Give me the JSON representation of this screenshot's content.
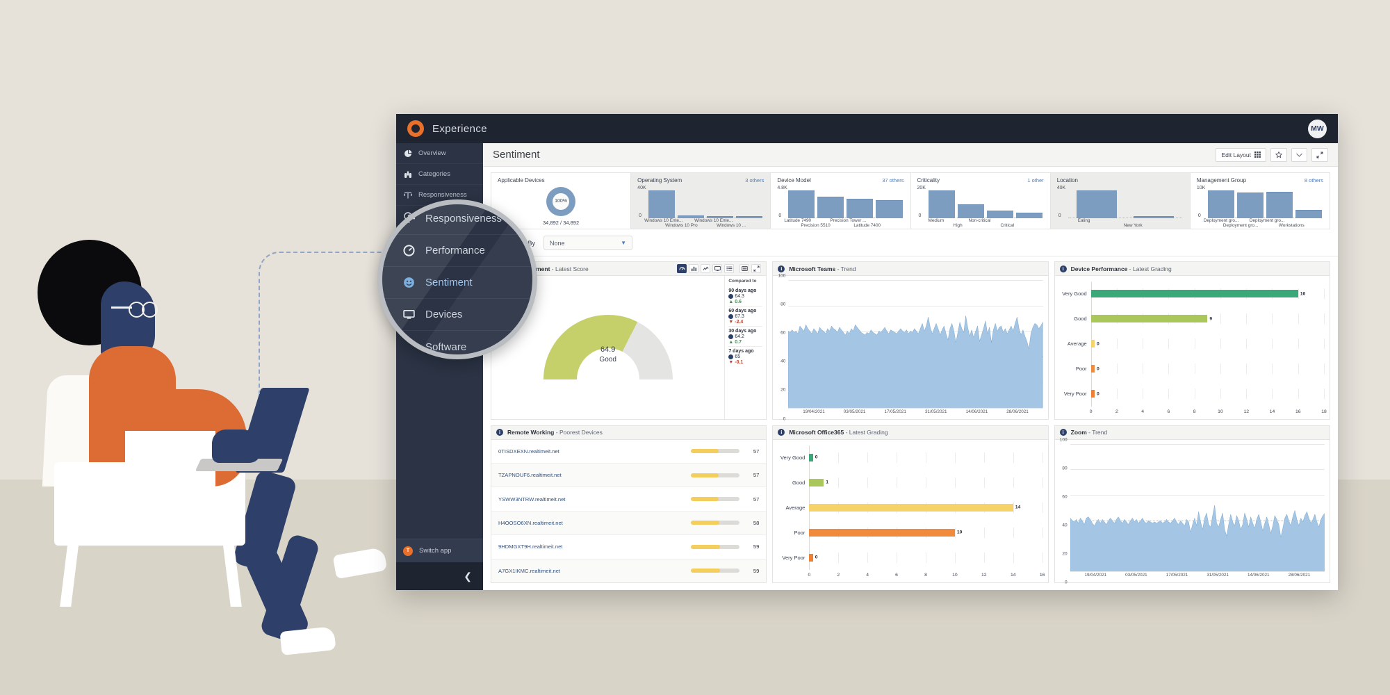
{
  "app": {
    "brand_title": "Experience",
    "brand_logo_icon": "tanium-logo-icon",
    "avatar_initials": "MW"
  },
  "sidebar": {
    "items": [
      {
        "label": "Overview",
        "icon": "pie-chart-icon",
        "selected": false
      },
      {
        "label": "Categories",
        "icon": "binoculars-icon",
        "selected": false
      },
      {
        "label": "Responsiveness",
        "icon": "scales-icon",
        "selected": false
      },
      {
        "label": "Performance",
        "icon": "speedometer-icon",
        "selected": false
      },
      {
        "label": "Sentiment",
        "icon": "smiley-face-icon",
        "selected": true
      },
      {
        "label": "Devices",
        "icon": "monitor-icon",
        "selected": false
      },
      {
        "label": "Software",
        "icon": "document-icon",
        "selected": false
      }
    ],
    "switch_app": {
      "label": "Switch app",
      "icon": "tanium-badge-icon"
    },
    "collapse_icon": "chevron-left-icon"
  },
  "magnifier": {
    "items": [
      {
        "label": "Responsiveness",
        "icon": "scales-icon",
        "selected": false
      },
      {
        "label": "Performance",
        "icon": "speedometer-icon",
        "selected": false
      },
      {
        "label": "Sentiment",
        "icon": "smiley-face-icon",
        "selected": true
      },
      {
        "label": "Devices",
        "icon": "monitor-icon",
        "selected": false
      },
      {
        "label": "Software",
        "icon": "document-icon",
        "selected": false
      }
    ]
  },
  "header": {
    "page_title": "Sentiment",
    "edit_layout_label": "Edit Layout",
    "edit_layout_icon": "grid-icon",
    "favorite_icon": "star-icon",
    "dropdown_icon": "chevron-down-icon",
    "expand_icon": "expand-arrows-icon"
  },
  "filters": [
    {
      "title": "Applicable Devices",
      "type": "donut",
      "percent": "100%",
      "subtext": "34,892 / 34,892",
      "others": ""
    },
    {
      "title": "Operating System",
      "others": "3 others",
      "type": "bar",
      "ymax": "40K",
      "ymin": "0",
      "bars": [
        100,
        9,
        8,
        7
      ],
      "labels": [
        "Windows 10 Ente...",
        "Windows 10 Pro",
        "Windows 10 Ente...",
        "Windows 10 ..."
      ]
    },
    {
      "title": "Device Model",
      "others": "37 others",
      "type": "bar",
      "ymax": "4.8K",
      "ymin": "0",
      "bars": [
        100,
        78,
        70,
        64
      ],
      "labels": [
        "Latitude 7490",
        "Precision 5510",
        "Precision Tower ...",
        "Latitude 7400"
      ]
    },
    {
      "title": "Criticality",
      "others": "1 other",
      "type": "bar",
      "ymax": "20K",
      "ymin": "0",
      "bars": [
        100,
        50,
        27,
        19
      ],
      "labels": [
        "Medium",
        "High",
        "Non-critical",
        "Critical"
      ]
    },
    {
      "title": "Location",
      "others": "",
      "type": "bar",
      "ymax": "40K",
      "ymin": "0",
      "bars": [
        100,
        7
      ],
      "labels": [
        "Ealing",
        "New York"
      ]
    },
    {
      "title": "Management Group",
      "others": "8 others",
      "type": "bar",
      "ymax": "10K",
      "ymin": "0",
      "bars": [
        100,
        93,
        94,
        30
      ],
      "labels": [
        "Deployment gro...",
        "Deployment gro...",
        "Deployment gro...",
        "Workstations"
      ]
    }
  ],
  "breakdown": {
    "label": "Break Down By",
    "value": "None",
    "caret_icon": "chevron-down-icon"
  },
  "panels": {
    "user_sentiment": {
      "title": "User sentiment",
      "subtitle": "- Latest Score",
      "info_icon": "info-icon",
      "tools": [
        {
          "name": "gauge-view-icon",
          "active": true
        },
        {
          "name": "bar-chart-view-icon",
          "active": false
        },
        {
          "name": "line-chart-view-icon",
          "active": false
        },
        {
          "name": "monitor-view-icon",
          "active": false
        },
        {
          "name": "list-view-icon",
          "active": false
        },
        {
          "name": "table-view-icon",
          "active": false
        },
        {
          "name": "expand-panel-icon",
          "active": false
        }
      ],
      "gauge_value": "64.9",
      "gauge_label": "Good",
      "compare_heading": "Compared to",
      "comparisons": [
        {
          "when": "90 days ago",
          "score": "64.3",
          "delta": "0.6",
          "direction": "up"
        },
        {
          "when": "60 days ago",
          "score": "67.3",
          "delta": "-2.4",
          "direction": "down"
        },
        {
          "when": "30 days ago",
          "score": "64.2",
          "delta": "0.7",
          "direction": "up"
        },
        {
          "when": "7 days ago",
          "score": "65",
          "delta": "-0.1",
          "direction": "down"
        }
      ]
    },
    "teams_trend": {
      "title": "Microsoft Teams",
      "subtitle": "- Trend",
      "info_icon": "info-icon"
    },
    "device_performance": {
      "title": "Device Performance",
      "subtitle": "- Latest Grading",
      "info_icon": "info-icon"
    },
    "remote_working": {
      "title": "Remote Working",
      "subtitle": "- Poorest Devices",
      "info_icon": "info-icon",
      "rows": [
        {
          "name": "0TISDXEXN.realtimeit.net",
          "score": "57",
          "pct": 57
        },
        {
          "name": "TZAPNOUF6.realtimeit.net",
          "score": "57",
          "pct": 57
        },
        {
          "name": "YSWW3NTRW.realtimeit.net",
          "score": "57",
          "pct": 57
        },
        {
          "name": "H4OOSO6XN.realtimeit.net",
          "score": "58",
          "pct": 58
        },
        {
          "name": "9HDMGXT9H.realtimeit.net",
          "score": "59",
          "pct": 59
        },
        {
          "name": "A7GX1IKMC.realtimeit.net",
          "score": "59",
          "pct": 59
        }
      ]
    },
    "office365": {
      "title": "Microsoft Office365",
      "subtitle": "- Latest Grading",
      "info_icon": "info-icon"
    },
    "zoom_trend": {
      "title": "Zoom",
      "subtitle": "- Trend",
      "info_icon": "info-icon"
    }
  },
  "colors": {
    "brand_orange": "#e8702a",
    "sidebar_dark": "#2b3344",
    "topbar_dark": "#1e2430",
    "accent_blue": "#4f7cc0",
    "bar_blue": "#7c9dc0",
    "area_blue": "#9dc0e0",
    "gauge_good": "#c6d06a",
    "grade_very_good": "#3aa878",
    "grade_good": "#a9c košick",
    "up_green": "#3f8f4e",
    "down_red": "#c0402b",
    "score_yellow": "#f3ce5c"
  },
  "chart_data": [
    {
      "type": "bar",
      "title": "Operating System",
      "categories": [
        "Windows 10 Ente...",
        "Windows 10 Pro",
        "Windows 10 Ente...",
        "Windows 10 ..."
      ],
      "values": [
        40,
        3.6,
        3.2,
        2.8
      ],
      "ylim": [
        0,
        40
      ],
      "ylabel": "40K",
      "grid": false
    },
    {
      "type": "bar",
      "title": "Device Model",
      "categories": [
        "Latitude 7490",
        "Precision 5510",
        "Precision Tower ...",
        "Latitude 7400"
      ],
      "values": [
        4.8,
        3.74,
        3.36,
        3.07
      ],
      "ylim": [
        0,
        4.8
      ],
      "ylabel": "4.8K",
      "grid": false
    },
    {
      "type": "bar",
      "title": "Criticality",
      "categories": [
        "Medium",
        "High",
        "Non-critical",
        "Critical"
      ],
      "values": [
        20,
        10,
        5.4,
        3.8
      ],
      "ylim": [
        0,
        20
      ],
      "ylabel": "20K",
      "grid": false
    },
    {
      "type": "bar",
      "title": "Location",
      "categories": [
        "Ealing",
        "New York"
      ],
      "values": [
        40,
        2.8
      ],
      "ylim": [
        0,
        40
      ],
      "ylabel": "40K",
      "grid": false
    },
    {
      "type": "bar",
      "title": "Management Group",
      "categories": [
        "Deployment gro...",
        "Deployment gro...",
        "Deployment gro...",
        "Workstations"
      ],
      "values": [
        10,
        9.3,
        9.4,
        3.0
      ],
      "ylim": [
        0,
        10
      ],
      "ylabel": "10K",
      "grid": false
    },
    {
      "type": "pie",
      "title": "Applicable Devices",
      "labels": [
        "Applicable"
      ],
      "values": [
        100
      ],
      "center_label": "100%",
      "subtext": "34,892 / 34,892"
    },
    {
      "type": "gauge",
      "title": "User sentiment - Latest Score",
      "value": 64.9,
      "label": "Good",
      "range": [
        0,
        100
      ],
      "comparisons": [
        {
          "period": "90 days ago",
          "value": 64.3,
          "delta": 0.6
        },
        {
          "period": "60 days ago",
          "value": 67.3,
          "delta": -2.4
        },
        {
          "period": "30 days ago",
          "value": 64.2,
          "delta": 0.7
        },
        {
          "period": "7 days ago",
          "value": 65,
          "delta": -0.1
        }
      ]
    },
    {
      "type": "area",
      "title": "Microsoft Teams - Trend",
      "ylim": [
        0,
        100
      ],
      "yticks": [
        0,
        20,
        40,
        60,
        80,
        100
      ],
      "xticks": [
        "19/04/2021",
        "03/05/2021",
        "17/05/2021",
        "31/05/2021",
        "14/06/2021",
        "28/06/2021"
      ],
      "series": [
        {
          "name": "Microsoft Teams score",
          "values": [
            60,
            59,
            61,
            59,
            60,
            58,
            64,
            62,
            60,
            65,
            62,
            60,
            58,
            62,
            60,
            58,
            63,
            61,
            60,
            58,
            62,
            60,
            64,
            62,
            61,
            59,
            63,
            61,
            59,
            57,
            60,
            58,
            62,
            60,
            65,
            63,
            61,
            59,
            58,
            57,
            59,
            58,
            61,
            59,
            58,
            57,
            60,
            59,
            61,
            63,
            60,
            58,
            61,
            60,
            59,
            58,
            60,
            62,
            60,
            59,
            61,
            58,
            60,
            59,
            62,
            60,
            58,
            62,
            66,
            60,
            64,
            71,
            63,
            58,
            62,
            66,
            62,
            57,
            61,
            64,
            58,
            53,
            62,
            66,
            60,
            51,
            59,
            67,
            62,
            59,
            72,
            63,
            56,
            61,
            55,
            60,
            64,
            52,
            57,
            62,
            68,
            58,
            63,
            51,
            61,
            66,
            60,
            63,
            64,
            59,
            62,
            58,
            61,
            64,
            60,
            66,
            71,
            62,
            57,
            61,
            56,
            52,
            46,
            58,
            63,
            66,
            65,
            62,
            64,
            67
          ]
        }
      ]
    },
    {
      "type": "bar",
      "orientation": "horizontal",
      "title": "Device Performance - Latest Grading",
      "categories": [
        "Very Good",
        "Good",
        "Average",
        "Poor",
        "Very Poor"
      ],
      "values": [
        16,
        9,
        0,
        0,
        0
      ],
      "colors": [
        "#3aa878",
        "#a9c75a",
        "#f6d26a",
        "#f08a3c",
        "#ef8030"
      ],
      "xlim": [
        0,
        18
      ],
      "xticks": [
        0,
        2,
        4,
        6,
        8,
        10,
        12,
        14,
        16,
        18
      ]
    },
    {
      "type": "bar",
      "orientation": "horizontal",
      "title": "Microsoft Office365 - Latest Grading",
      "categories": [
        "Very Good",
        "Good",
        "Average",
        "Poor",
        "Very Poor"
      ],
      "values": [
        0,
        1,
        14,
        10,
        0
      ],
      "colors": [
        "#3aa878",
        "#a9c75a",
        "#f6d26a",
        "#f08a3c",
        "#ef8030"
      ],
      "xlim": [
        0,
        16
      ],
      "xticks": [
        0,
        2,
        4,
        6,
        8,
        10,
        12,
        14,
        16
      ]
    },
    {
      "type": "area",
      "title": "Zoom - Trend",
      "ylim": [
        0,
        100
      ],
      "yticks": [
        0,
        20,
        40,
        60,
        80,
        100
      ],
      "xticks": [
        "19/04/2021",
        "03/05/2021",
        "17/05/2021",
        "31/05/2021",
        "14/06/2021",
        "28/06/2021"
      ],
      "series": [
        {
          "name": "Zoom score",
          "values": [
            42,
            40,
            39,
            41,
            38,
            42,
            40,
            37,
            42,
            43,
            41,
            38,
            36,
            39,
            41,
            38,
            41,
            39,
            37,
            40,
            42,
            40,
            38,
            41,
            43,
            40,
            38,
            41,
            39,
            37,
            40,
            42,
            39,
            41,
            38,
            40,
            42,
            39,
            38,
            40,
            39,
            38,
            39,
            38,
            39,
            40,
            38,
            39,
            41,
            39,
            38,
            40,
            42,
            39,
            37,
            40,
            38,
            36,
            41,
            39,
            31,
            37,
            42,
            36,
            47,
            39,
            33,
            42,
            46,
            37,
            35,
            44,
            52,
            38,
            35,
            41,
            46,
            33,
            28,
            37,
            45,
            39,
            36,
            44,
            40,
            33,
            37,
            46,
            41,
            35,
            43,
            38,
            34,
            41,
            45,
            39,
            32,
            38,
            43,
            37,
            30,
            36,
            44,
            41,
            37,
            27,
            34,
            42,
            45,
            40,
            36,
            43,
            48,
            41,
            36,
            42,
            39,
            44,
            47,
            42,
            38,
            41,
            45,
            39,
            35,
            41,
            44,
            46
          ]
        }
      ]
    },
    {
      "type": "bar",
      "orientation": "horizontal",
      "title": "Remote Working - Poorest Devices",
      "categories": [
        "0TISDXEXN.realtimeit.net",
        "TZAPNOUF6.realtimeit.net",
        "YSWW3NTRW.realtimeit.net",
        "H4OOSO6XN.realtimeit.net",
        "9HDMGXT9H.realtimeit.net",
        "A7GX1IKMC.realtimeit.net"
      ],
      "values": [
        57,
        57,
        57,
        58,
        59,
        59
      ],
      "xlim": [
        0,
        100
      ]
    }
  ]
}
